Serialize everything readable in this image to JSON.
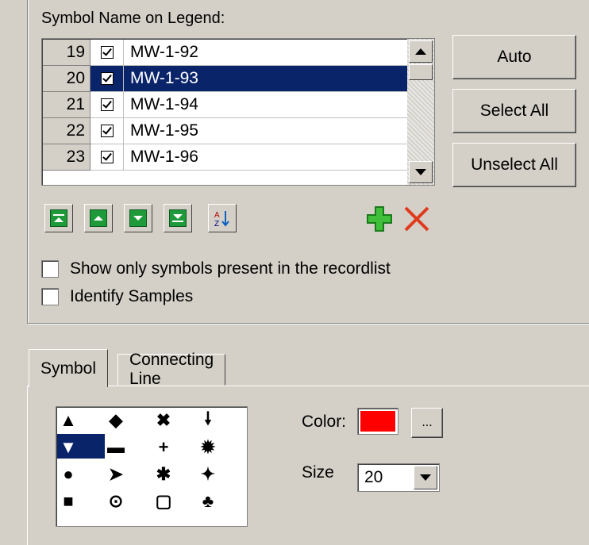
{
  "legend": {
    "title": "Symbol Name on Legend:",
    "rows": [
      {
        "num": "19",
        "name": "MW-1-92",
        "checked": true,
        "selected": false
      },
      {
        "num": "20",
        "name": "MW-1-93",
        "checked": true,
        "selected": true
      },
      {
        "num": "21",
        "name": "MW-1-94",
        "checked": true,
        "selected": false
      },
      {
        "num": "22",
        "name": "MW-1-95",
        "checked": true,
        "selected": false
      },
      {
        "num": "23",
        "name": "MW-1-96",
        "checked": true,
        "selected": false
      }
    ]
  },
  "buttons": {
    "auto": "Auto",
    "select_all": "Select All",
    "unselect_all": "Unselect All"
  },
  "toolbar": {
    "icons": [
      "move-top-icon",
      "move-up-icon",
      "move-down-icon",
      "move-bottom-icon",
      "sort-az-icon",
      "add-icon",
      "delete-icon"
    ]
  },
  "options": {
    "show_only_present": "Show only symbols present in the recordlist",
    "identify_samples": "Identify Samples"
  },
  "tabs": {
    "symbol": "Symbol",
    "connecting_line": "Connecting Line"
  },
  "symbol": {
    "color_label": "Color:",
    "color_value": "#ff0000",
    "color_button": "...",
    "size_label": "Size",
    "size_value": "20",
    "glyphs": [
      [
        "▲",
        "◆",
        "✖",
        "🠗"
      ],
      [
        "▼",
        "▬",
        "+",
        "✹"
      ],
      [
        "●",
        "➤",
        "✱",
        "✦"
      ],
      [
        "■",
        "⊙",
        "▢",
        "♣"
      ]
    ]
  },
  "colors": {
    "selection": "#0a246a",
    "face": "#d4d0c8",
    "icon_green": "#1e9a3a",
    "delete_red": "#e03a1e"
  }
}
